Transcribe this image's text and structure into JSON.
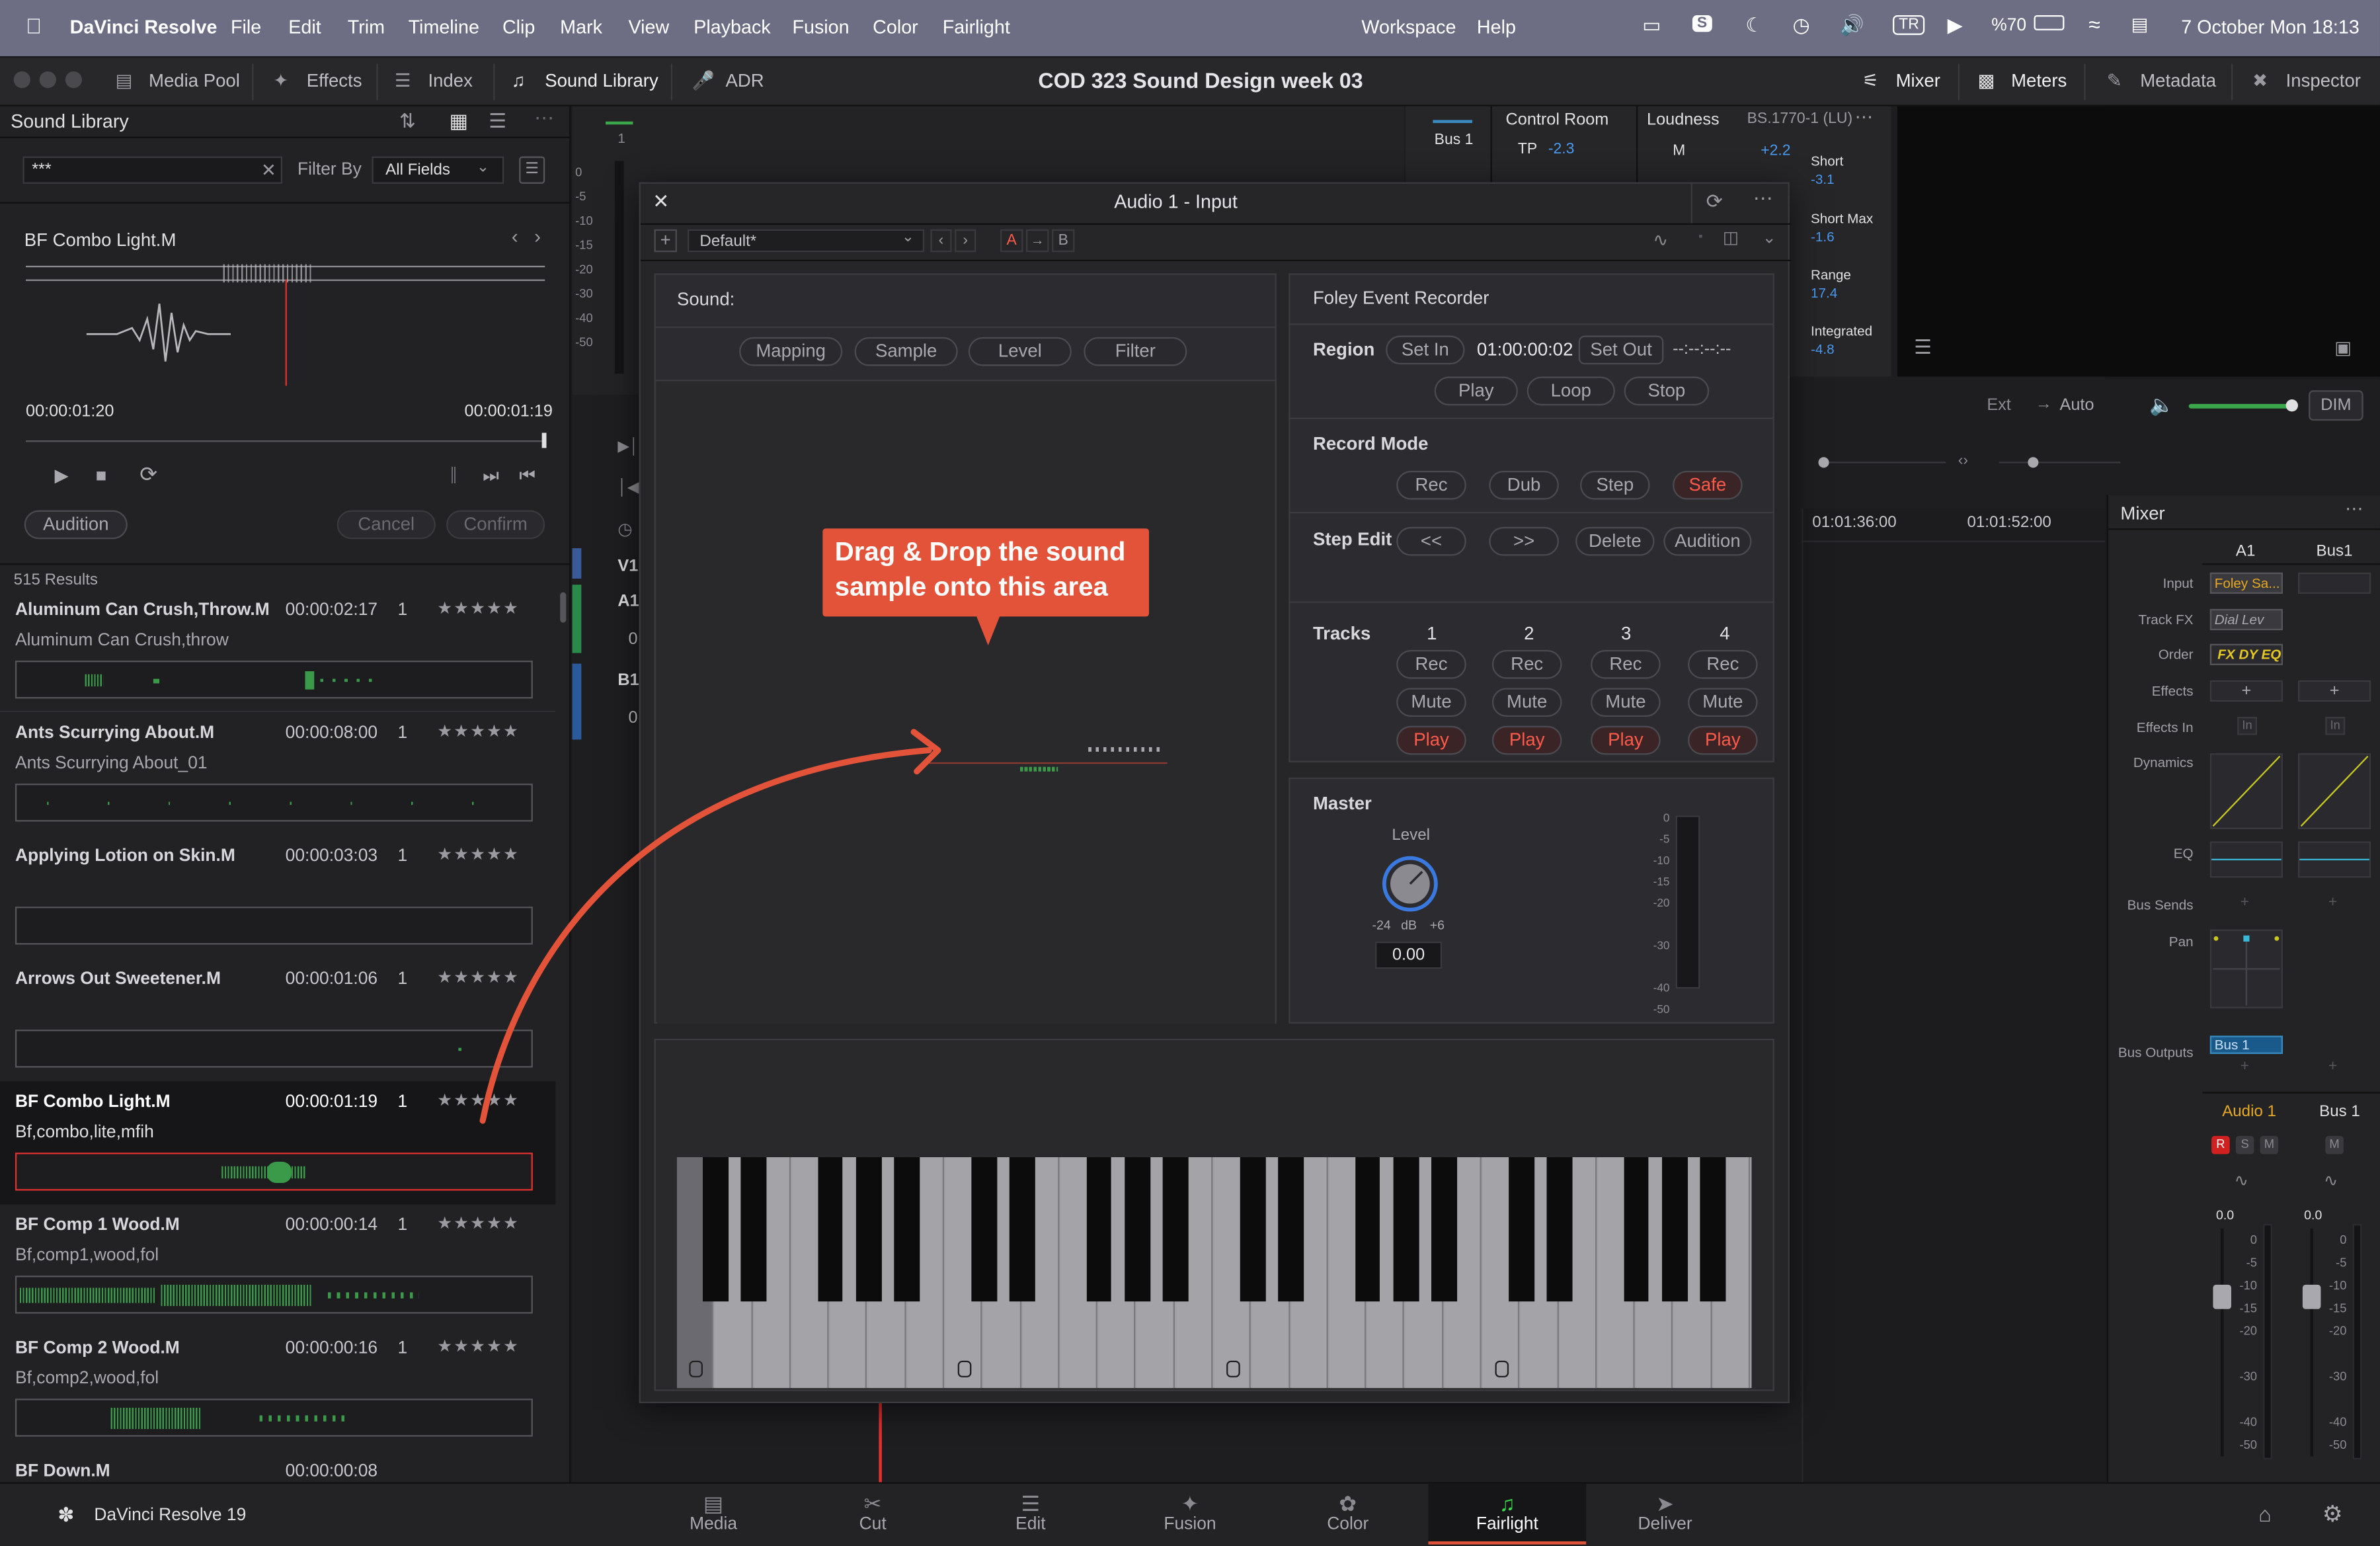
{
  "mac_menu": {
    "apple": "",
    "app_name": "DaVinci Resolve",
    "items": [
      "File",
      "Edit",
      "Trim",
      "Timeline",
      "Clip",
      "Mark",
      "View",
      "Playback",
      "Fusion",
      "Color",
      "Fairlight"
    ],
    "right_items": [
      "Workspace",
      "Help"
    ],
    "battery": "%70",
    "lang": "TR",
    "clock": "7 October Mon  18:13"
  },
  "toolbar": {
    "media_pool": "Media Pool",
    "effects": "Effects",
    "index": "Index",
    "sound_library": "Sound Library",
    "adr": "ADR",
    "project_title": "COD 323 Sound Design week 03",
    "mixer": "Mixer",
    "meters": "Meters",
    "metadata": "Metadata",
    "inspector": "Inspector"
  },
  "sound_library": {
    "title": "Sound Library",
    "search_value": "***",
    "filter_by_label": "Filter By",
    "filter_value": "All Fields",
    "preview_name": "BF Combo Light.M",
    "time_start": "00:00:01:20",
    "time_end": "00:00:01:19",
    "audition": "Audition",
    "cancel": "Cancel",
    "confirm": "Confirm",
    "results_count": "515 Results",
    "results": [
      {
        "name": "Aluminum Can Crush,Throw.M",
        "duration": "00:00:02:17",
        "channels": "1",
        "desc": "Aluminum Can Crush,throw"
      },
      {
        "name": "Ants Scurrying About.M",
        "duration": "00:00:08:00",
        "channels": "1",
        "desc": "Ants Scurrying About_01"
      },
      {
        "name": "Applying Lotion on Skin.M",
        "duration": "00:00:03:03",
        "channels": "1",
        "desc": ""
      },
      {
        "name": "Arrows Out Sweetener.M",
        "duration": "00:00:01:06",
        "channels": "1",
        "desc": ""
      },
      {
        "name": "BF Combo Light.M",
        "duration": "00:00:01:19",
        "channels": "1",
        "desc": "Bf,combo,lite,mfih"
      },
      {
        "name": "BF Comp 1 Wood.M",
        "duration": "00:00:00:14",
        "channels": "1",
        "desc": "Bf,comp1,wood,fol"
      },
      {
        "name": "BF Comp 2 Wood.M",
        "duration": "00:00:00:16",
        "channels": "1",
        "desc": "Bf,comp2,wood,fol"
      },
      {
        "name": "BF Down.M",
        "duration": "00:00:00:08",
        "channels": "",
        "desc": ""
      }
    ]
  },
  "tracks": {
    "v1": "V1",
    "a1": "A1",
    "b1": "B1",
    "zero": "0",
    "meter_top": "1"
  },
  "meters_panel": {
    "bus1": "Bus 1",
    "control_room": "Control Room",
    "tp_label": "TP",
    "tp_value": "-2.3",
    "loudness": "Loudness",
    "loudness_std": "BS.1770-1 (LU)",
    "m_label": "M",
    "m_value": "+2.2",
    "short_label": "Short",
    "short_value": "-3.1",
    "short_max_label": "Short Max",
    "short_max_value": "-1.6",
    "range_label": "Range",
    "range_value": "17.4",
    "integrated_label": "Integrated",
    "integrated_value": "-4.8"
  },
  "dialog": {
    "title": "Audio 1 -  Input",
    "preset": "Default*",
    "a": "A",
    "b": "B",
    "sound_label": "Sound:",
    "tabs": [
      "Mapping",
      "Sample",
      "Level",
      "Filter"
    ],
    "callout": "Drag & Drop the sound sample onto this area",
    "foley_title": "Foley Event Recorder",
    "region_label": "Region",
    "set_in": "Set In",
    "region_tc": "01:00:00:02",
    "set_out": "Set Out",
    "out_tc": "--:--:--:--",
    "play": "Play",
    "loop": "Loop",
    "stop": "Stop",
    "record_mode_label": "Record Mode",
    "modes": [
      "Rec",
      "Dub",
      "Step",
      "Safe"
    ],
    "step_edit_label": "Step Edit",
    "step_prev": "<<",
    "step_next": ">>",
    "delete": "Delete",
    "audition": "Audition",
    "tracks_label": "Tracks",
    "track_numbers": [
      "1",
      "2",
      "3",
      "4"
    ],
    "rec": "Rec",
    "mute": "Mute",
    "master_label": "Master",
    "level_label": "Level",
    "knob_min": "-24",
    "knob_unit": "dB",
    "knob_max": "+6",
    "knob_value": "0.00",
    "meter_scale": [
      "0",
      "-5",
      "-10",
      "-15",
      "-20",
      "-30",
      "-40",
      "-50"
    ]
  },
  "monitor": {
    "ext": "Ext",
    "auto": "Auto",
    "dim": "DIM"
  },
  "timeline": {
    "tc1": "01:01:36:00",
    "tc2": "01:01:52:00"
  },
  "mixer": {
    "title": "Mixer",
    "col_a1": "A1",
    "col_bus1": "Bus1",
    "rows": [
      "Input",
      "Track FX",
      "Order",
      "Effects",
      "Effects In",
      "Dynamics",
      "EQ",
      "Bus Sends",
      "Pan",
      "Bus Outputs"
    ],
    "input_value": "Foley Sa...",
    "trackfx_value": "Dial Lev",
    "order_value": "FX DY EQ",
    "effects_in": "In",
    "bus_out": "Bus 1",
    "ch_name_a1": "Audio 1",
    "ch_name_bus": "Bus 1",
    "r": "R",
    "s": "S",
    "m": "M",
    "fader_value": "0.0",
    "scale": [
      "0",
      "-5",
      "-10",
      "-15",
      "-20",
      "-30",
      "-40",
      "-50"
    ]
  },
  "pages": {
    "brand": "DaVinci Resolve 19",
    "items": [
      "Media",
      "Cut",
      "Edit",
      "Fusion",
      "Color",
      "Fairlight",
      "Deliver"
    ],
    "active": "Fairlight"
  }
}
